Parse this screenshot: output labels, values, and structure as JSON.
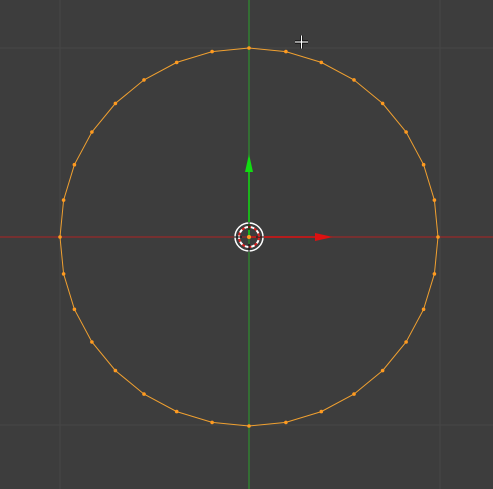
{
  "viewport": {
    "background": "#3d3d3d",
    "grid_color": "#474747",
    "x_axis_color": "#b02222",
    "y_axis_color": "#2aa02a"
  },
  "mesh": {
    "object_type": "circle",
    "vertex_count": 32,
    "selected": true,
    "edge_color": "#f0a030",
    "vertex_color": "#ff9a1f"
  },
  "gizmo": {
    "type": "translate-manipulator",
    "x_handle_color": "#dd1111",
    "y_handle_color": "#11dd11"
  },
  "cursor_3d": {
    "icon": "3d-cursor-icon"
  },
  "mouse_cursor": {
    "icon": "crosshair-cursor-icon"
  }
}
